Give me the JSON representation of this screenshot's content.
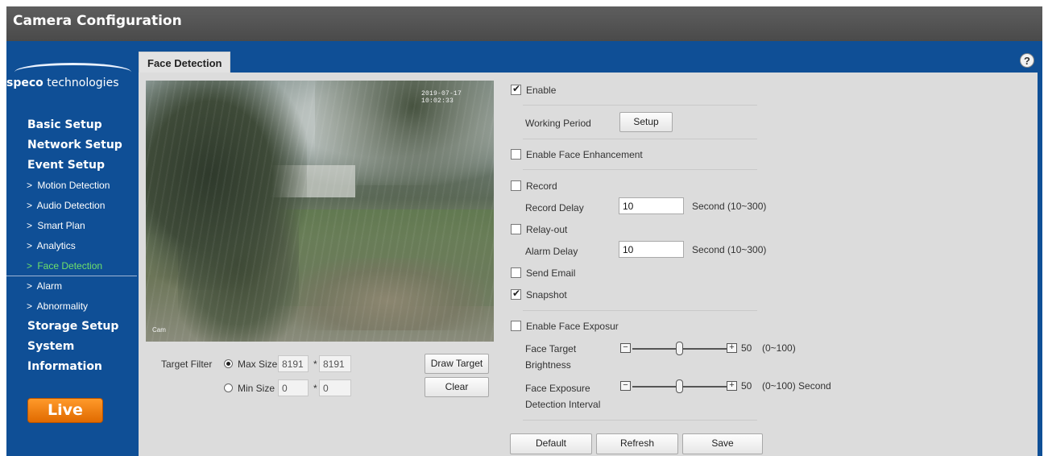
{
  "app": {
    "title": "Camera Configuration"
  },
  "logo": {
    "brand_bold": "speco",
    "brand_rest": " technologies"
  },
  "nav": {
    "items": [
      {
        "label": "Basic Setup",
        "type": "top"
      },
      {
        "label": "Network Setup",
        "type": "top"
      },
      {
        "label": "Event Setup",
        "type": "top"
      },
      {
        "label": "Motion Detection",
        "type": "sub"
      },
      {
        "label": "Audio Detection",
        "type": "sub"
      },
      {
        "label": "Smart Plan",
        "type": "sub"
      },
      {
        "label": "Analytics",
        "type": "sub"
      },
      {
        "label": "Face Detection",
        "type": "sub",
        "active": true
      },
      {
        "label": "Alarm",
        "type": "sub"
      },
      {
        "label": "Abnormality",
        "type": "sub"
      },
      {
        "label": "Storage Setup",
        "type": "top"
      },
      {
        "label": "System",
        "type": "top"
      },
      {
        "label": "Information",
        "type": "top"
      }
    ],
    "live_label": "Live"
  },
  "tab": {
    "label": "Face Detection"
  },
  "help_icon": "?",
  "video": {
    "timestamp": "2019-07-17 10:02:33",
    "camera_name": "Cam"
  },
  "target_filter": {
    "label": "Target Filter",
    "max": {
      "label": "Max Size",
      "w": "8191",
      "h": "8191",
      "selected": true
    },
    "min": {
      "label": "Min Size",
      "w": "0",
      "h": "0",
      "selected": false
    },
    "sep": "*",
    "draw_target": "Draw Target",
    "clear": "Clear"
  },
  "settings": {
    "enable": {
      "label": "Enable",
      "checked": true
    },
    "working_period": {
      "label": "Working Period",
      "button": "Setup"
    },
    "face_enhancement": {
      "label": "Enable Face Enhancement",
      "checked": false
    },
    "record": {
      "label": "Record",
      "checked": false
    },
    "record_delay": {
      "label": "Record Delay",
      "value": "10",
      "unit": "Second (10~300)"
    },
    "relay_out": {
      "label": "Relay-out",
      "checked": false
    },
    "alarm_delay": {
      "label": "Alarm Delay",
      "value": "10",
      "unit": "Second (10~300)"
    },
    "send_email": {
      "label": "Send Email",
      "checked": false
    },
    "snapshot": {
      "label": "Snapshot",
      "checked": true
    },
    "face_exposure": {
      "label": "Enable Face Exposur",
      "checked": false
    },
    "face_target_brightness": {
      "label_line1": "Face Target",
      "label_line2": "Brightness",
      "value": "50",
      "range": "(0~100)",
      "level": 0.5
    },
    "face_exposure_interval": {
      "label_line1": "Face Exposure",
      "label_line2": "Detection Interval",
      "value": "50",
      "range": "(0~100) Second",
      "level": 0.5
    },
    "slider_minus": "−",
    "slider_plus": "+"
  },
  "footer": {
    "default": "Default",
    "refresh": "Refresh",
    "save": "Save"
  }
}
